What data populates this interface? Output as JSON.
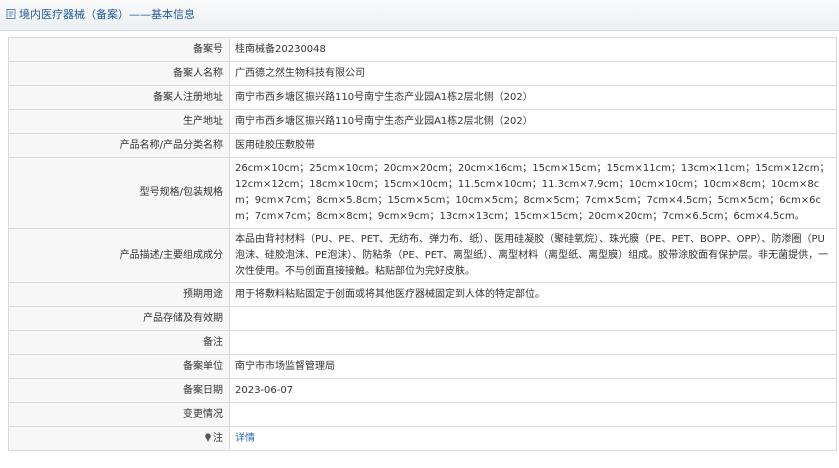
{
  "header": {
    "title": "境内医疗器械（备案）——基本信息"
  },
  "fields": [
    {
      "label": "备案号",
      "value": "桂南械备20230048"
    },
    {
      "label": "备案人名称",
      "value": "广西德之然生物科技有限公司"
    },
    {
      "label": "备案人注册地址",
      "value": "南宁市西乡塘区振兴路110号南宁生态产业园A1栋2层北侧（202）"
    },
    {
      "label": "生产地址",
      "value": "南宁市西乡塘区振兴路110号南宁生态产业园A1栋2层北侧（202）"
    },
    {
      "label": "产品名称/产品分类名称",
      "value": "医用硅胶压敷胶带"
    },
    {
      "label": "型号规格/包装规格",
      "value": "26cm×10cm；25cm×10cm；20cm×20cm；20cm×16cm；15cm×15cm；15cm×11cm；13cm×11cm；15cm×12cm；12cm×12cm；18cm×10cm；15cm×10cm；11.5cm×10cm；11.3cm×7.9cm；10cm×10cm；10cm×8cm；10cm×8cm；9cm×7cm；8cm×5.8cm；15cm×5cm；10cm×5cm；8cm×5cm；7cm×5cm；7cm×4.5cm；5cm×5cm；6cm×6cm；7cm×7cm；8cm×8cm；9cm×9cm；13cm×13cm；15cm×15cm；20cm×20cm；7cm×6.5cm；6cm×4.5cm。"
    },
    {
      "label": "产品描述/主要组成成分",
      "value": "本品由背衬材料（PU、PE、PET、无纺布、弹力布、纸）、医用硅凝胶（聚硅氧烷）、珠光膜（PE、PET、BOPP、OPP）、防渗圈（PU泡沫、硅胶泡沫、PE泡沫）、防粘条（PE、PET、离型纸）、离型材料（离型纸、离型膜）组成。胶带涂胶面有保护层。非无菌提供，一次性使用。不与创面直接接触。粘贴部位为完好皮肤。"
    },
    {
      "label": "预期用途",
      "value": "用于将敷料粘贴固定于创面或将其他医疗器械固定到人体的特定部位。"
    },
    {
      "label": "产品存储及有效期",
      "value": ""
    },
    {
      "label": "备注",
      "value": ""
    },
    {
      "label": "备案单位",
      "value": "南宁市市场监督管理局"
    },
    {
      "label": "备案日期",
      "value": "2023-06-07"
    },
    {
      "label": "变更情况",
      "value": ""
    },
    {
      "label": "注",
      "value": "详情",
      "icon": "pin-icon"
    }
  ],
  "colors": {
    "title": "#1f5c99",
    "label_bg": "#f7f7f7",
    "border": "#d9d9d9",
    "link": "#2a6cb3"
  }
}
